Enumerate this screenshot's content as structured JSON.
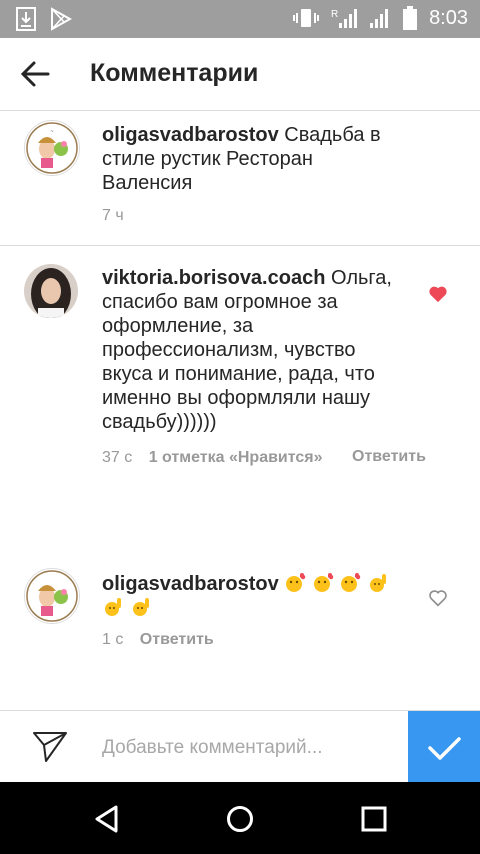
{
  "status_bar": {
    "time": "8:03"
  },
  "header": {
    "title": "Комментарии"
  },
  "comments": [
    {
      "username": "oligasvadbarostov",
      "text": "Свадьба в стиле рустик Ресторан Валенсия",
      "time": "7 ч",
      "liked": false
    },
    {
      "username": "viktoria.borisova.coach",
      "text": "Ольга, спасибо вам огромное за оформление, за профессионализм, чувство вкуса и понимание, рада, что именно вы оформляли нашу свадьбу))))))",
      "time": "37 с",
      "likes": "1 отметка «Нравится»",
      "reply": "Ответить",
      "liked": true
    },
    {
      "username": "oligasvadbarostov",
      "time": "1 с",
      "reply": "Ответить",
      "liked": false
    }
  ],
  "composer": {
    "placeholder": "Добавьте комментарий..."
  },
  "colors": {
    "accent": "#3897f0",
    "like": "#ed4956"
  }
}
